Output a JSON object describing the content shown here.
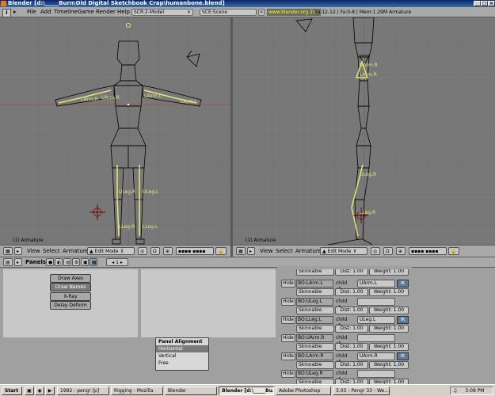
{
  "window": {
    "title": "Blender [d:\\_____Burn\\Old Digital Sketchbook Crap\\humanbone.blend]"
  },
  "menubar": {
    "info_icon": "i",
    "items": [
      "File",
      "Add",
      "Timeline",
      "Game",
      "Render",
      "Help"
    ],
    "screen": "SCR:2-Model",
    "scene": "SCE:Scene",
    "url": "www.blender.org 234",
    "stats": "Ve:12-12 | Fa:0-8 | Mem:1.29M Armature"
  },
  "viewport_left": {
    "label": "(1) Armature",
    "bone_labels": [
      "LArm.R",
      "UArm.R",
      "UArm.L",
      "LArm.L",
      "ULeg.R",
      "ULeg.L",
      "LLeg.R",
      "LLeg.L"
    ]
  },
  "viewport_right": {
    "label": "(1) Armature",
    "bone_labels": [
      "UArm.R",
      "LArm.R",
      "ULeg.R",
      "LLeg.R"
    ]
  },
  "header": {
    "view": "View",
    "select": "Select",
    "armature": "Armature",
    "mode": "Edit Mode"
  },
  "buttons": {
    "panels_label": "Panels",
    "page": "1",
    "draw_buttons": [
      "Draw Axes",
      "Draw Names",
      "X-Ray",
      "Delay Deform"
    ],
    "bones": [
      {
        "name": "BO:LArm.L",
        "parent": "UArm.L",
        "ik": true
      },
      {
        "name": "BO:ULeg.L",
        "parent": "",
        "ik": false
      },
      {
        "name": "BO:LLeg.L",
        "parent": "ULeg.L",
        "ik": true
      },
      {
        "name": "BO:UArm.R",
        "parent": "",
        "ik": false
      },
      {
        "name": "BO:LArm.R",
        "parent": "UArm.R",
        "ik": true
      },
      {
        "name": "BO:ULeg.R",
        "parent": "",
        "ik": false
      }
    ],
    "hide_label": "Hide",
    "childof_label": "child of",
    "ik_label": "IK",
    "skin_label": "Skinnable",
    "dist_label": "Dist: 1.00",
    "weight_label": "Weight: 1.00"
  },
  "panel_alignment": {
    "title": "Panel Alignment",
    "options": [
      "Horizontal",
      "Vertical",
      "Free"
    ],
    "selected": "Horizontal"
  },
  "taskbar": {
    "start": "Start",
    "tasks": [
      "1992 - peng! [p]",
      "Rigging - Mozilla",
      "Blender",
      "Blender [d:\\_____Bu...",
      "Adobe Photoshop",
      "3.03 - Peng! 33 - We..."
    ],
    "clock": "3:08 PM"
  },
  "colors": {
    "bone": "#e6e67a",
    "grid_red": "#a05050",
    "grid_green": "#509050",
    "accent": "#3a6ea5"
  }
}
